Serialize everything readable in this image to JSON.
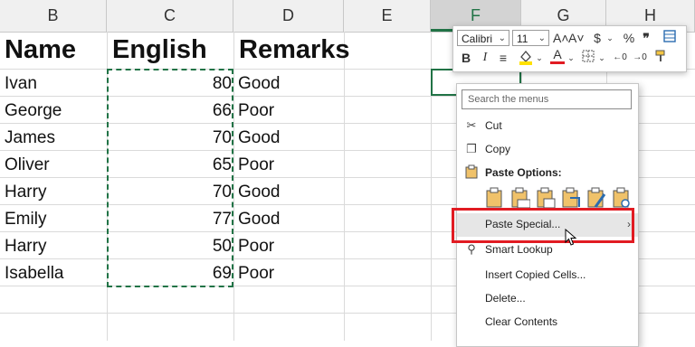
{
  "columns": [
    "B",
    "C",
    "D",
    "E",
    "F",
    "G",
    "H"
  ],
  "headers": {
    "name": "Name",
    "english": "English",
    "remarks": "Remarks"
  },
  "rows": [
    {
      "name": "Ivan",
      "english": "80",
      "remarks": "Good"
    },
    {
      "name": "George",
      "english": "66",
      "remarks": "Poor"
    },
    {
      "name": "James",
      "english": "70",
      "remarks": "Good"
    },
    {
      "name": "Oliver",
      "english": "65",
      "remarks": "Poor"
    },
    {
      "name": "Harry",
      "english": "70",
      "remarks": "Good"
    },
    {
      "name": "Emily",
      "english": "77",
      "remarks": "Good"
    },
    {
      "name": "Harry",
      "english": "50",
      "remarks": "Poor"
    },
    {
      "name": "Isabella",
      "english": "69",
      "remarks": "Poor"
    }
  ],
  "mini_toolbar": {
    "font": "Calibri",
    "size": "11",
    "grow_font": "A˄",
    "shrink_font": "A˅",
    "currency": "$",
    "percent": "%",
    "comma": "❞",
    "bold": "B",
    "italic": "I",
    "font_color": "A"
  },
  "menu": {
    "search_placeholder": "Search the menus",
    "cut": "Cut",
    "copy": "Copy",
    "paste_options": "Paste Options:",
    "paste_special": "Paste Special...",
    "smart_lookup": "Smart Lookup",
    "insert_copied_cells": "Insert Copied Cells...",
    "delete": "Delete...",
    "clear_contents": "Clear Contents"
  },
  "colors": {
    "excel_green": "#217346",
    "highlight_red": "#e11b22",
    "font_red": "#e11b22",
    "fill_yellow": "#ffe100"
  }
}
